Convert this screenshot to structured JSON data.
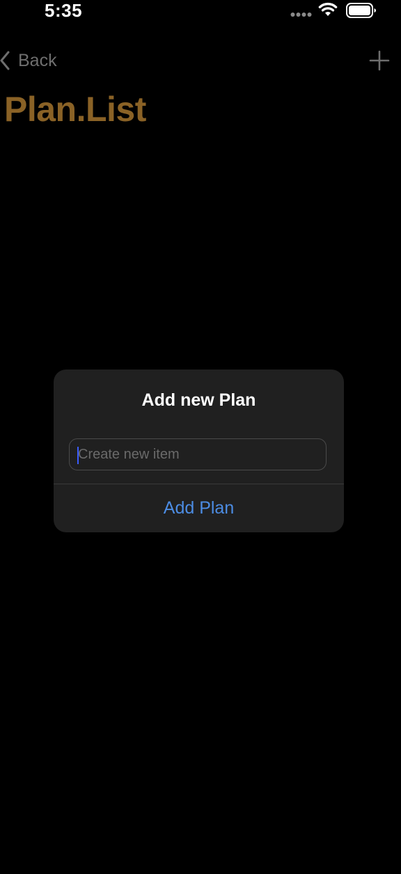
{
  "status_bar": {
    "time": "5:35"
  },
  "nav": {
    "back_label": "Back",
    "title": "Plan.List"
  },
  "alert": {
    "title": "Add new Plan",
    "input_value": "",
    "input_placeholder": "Create new item",
    "action_label": "Add Plan"
  },
  "colors": {
    "background": "#000000",
    "title_accent": "#8a6226",
    "alert_background": "#202020",
    "action_blue": "#4c8ce3",
    "caret": "#3a5cff"
  },
  "icons": {
    "signal": "signal-dots-icon",
    "wifi": "wifi-icon",
    "battery": "battery-icon",
    "back": "chevron-left-icon",
    "add": "plus-icon"
  }
}
